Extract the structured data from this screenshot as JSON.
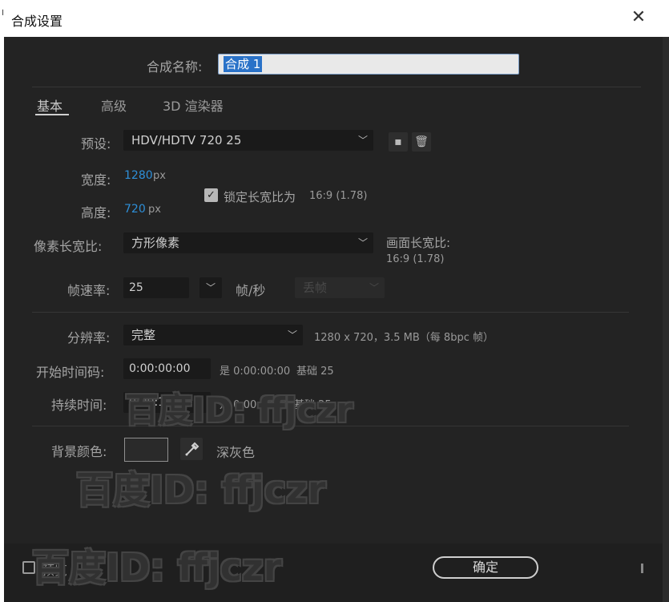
{
  "window": {
    "title": "合成设置"
  },
  "comp_name": {
    "label": "合成名称:",
    "value": "合成 1"
  },
  "tabs": [
    {
      "label": "基本",
      "active": true
    },
    {
      "label": "高级",
      "active": false
    },
    {
      "label": "3D 渲染器",
      "active": false
    }
  ],
  "preset": {
    "label": "预设:",
    "value": "HDV/HDTV 720 25"
  },
  "width": {
    "label": "宽度:",
    "value": "1280",
    "unit": "px"
  },
  "height": {
    "label": "高度:",
    "value": "720",
    "unit": "px"
  },
  "lock_aspect": {
    "label": "锁定长宽比为",
    "ratio": "16:9 (1.78)",
    "checked": true
  },
  "pixel_aspect": {
    "label": "像素长宽比:",
    "value": "方形像素"
  },
  "frame_aspect": {
    "label": "画面长宽比:",
    "value": "16:9 (1.78)"
  },
  "frame_rate": {
    "label": "帧速率:",
    "value": "25",
    "unit": "帧/秒",
    "drop_frame": "丢帧"
  },
  "resolution": {
    "label": "分辨率:",
    "value": "完整",
    "info": "1280 x 720，3.5 MB（每 8bpc 帧）"
  },
  "start_timecode": {
    "label": "开始时间码:",
    "value": "0:00:00:00",
    "is_text": "是 0:00:00:00",
    "base_text": "基础 25"
  },
  "duration": {
    "label": "持续时间:",
    "value": "0:00:10:00",
    "is_text": "是 0:00:10:00",
    "base_text": "基础 25"
  },
  "background": {
    "label": "背景颜色:",
    "color": "#2a2a2a",
    "color_name": "深灰色"
  },
  "footer": {
    "preview_label": "预览",
    "ok_label": "确定"
  },
  "watermark": {
    "text": "百度ID: ffjczr"
  },
  "icons": {
    "close": "close-icon",
    "save_preset": "save-preset-icon",
    "delete": "trash-icon",
    "eyedropper": "eyedropper-icon",
    "chevron": "chevron-down-icon",
    "check": "check-icon"
  }
}
